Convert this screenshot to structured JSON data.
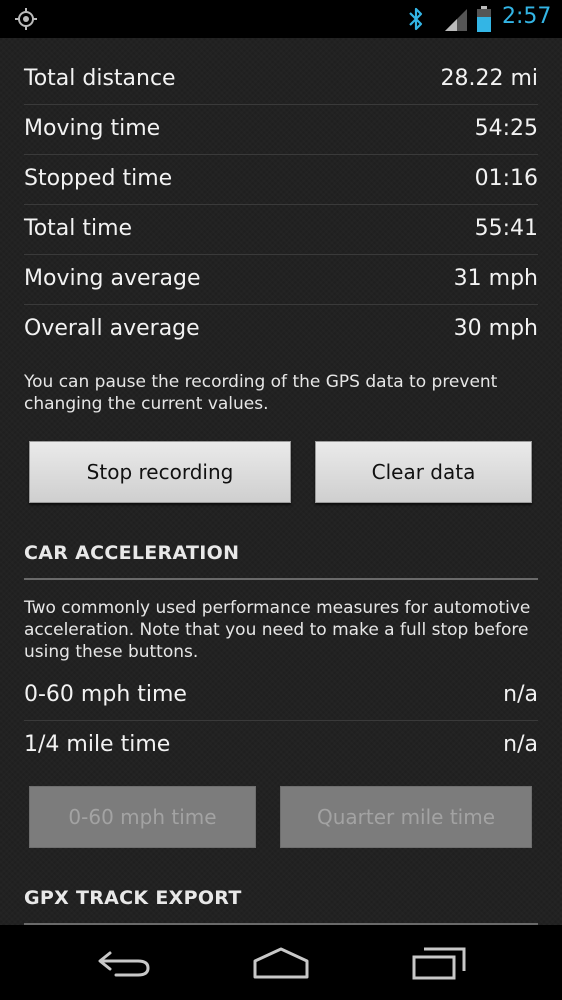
{
  "status_bar": {
    "time": "2:57",
    "icons": [
      "gps-icon",
      "bluetooth-icon",
      "signal-icon",
      "battery-icon"
    ],
    "clock_color": "#33b5e5"
  },
  "stats": [
    {
      "label": "Total distance",
      "value": "28.22 mi"
    },
    {
      "label": "Moving time",
      "value": "54:25"
    },
    {
      "label": "Stopped time",
      "value": "01:16"
    },
    {
      "label": "Total time",
      "value": "55:41"
    },
    {
      "label": "Moving average",
      "value": "31 mph"
    },
    {
      "label": "Overall average",
      "value": "30 mph"
    }
  ],
  "pause_note": "You can pause the recording of the GPS data to prevent changing the current values.",
  "buttons": {
    "stop_recording": "Stop recording",
    "clear_data": "Clear data"
  },
  "car_acceleration": {
    "header": "CAR ACCELERATION",
    "note": "Two commonly used performance measures for automotive acceleration. Note that you need to make a full stop before using these buttons.",
    "rows": [
      {
        "label": "0-60 mph time",
        "value": "n/a"
      },
      {
        "label": "1/4 mile time",
        "value": "n/a"
      }
    ],
    "buttons": {
      "zero_sixty": "0-60 mph time",
      "quarter_mile": "Quarter mile time"
    }
  },
  "gpx_export": {
    "header": "GPX TRACK EXPORT"
  },
  "nav_bar": {
    "icons": [
      "back-icon",
      "home-icon",
      "recent-apps-icon"
    ]
  }
}
